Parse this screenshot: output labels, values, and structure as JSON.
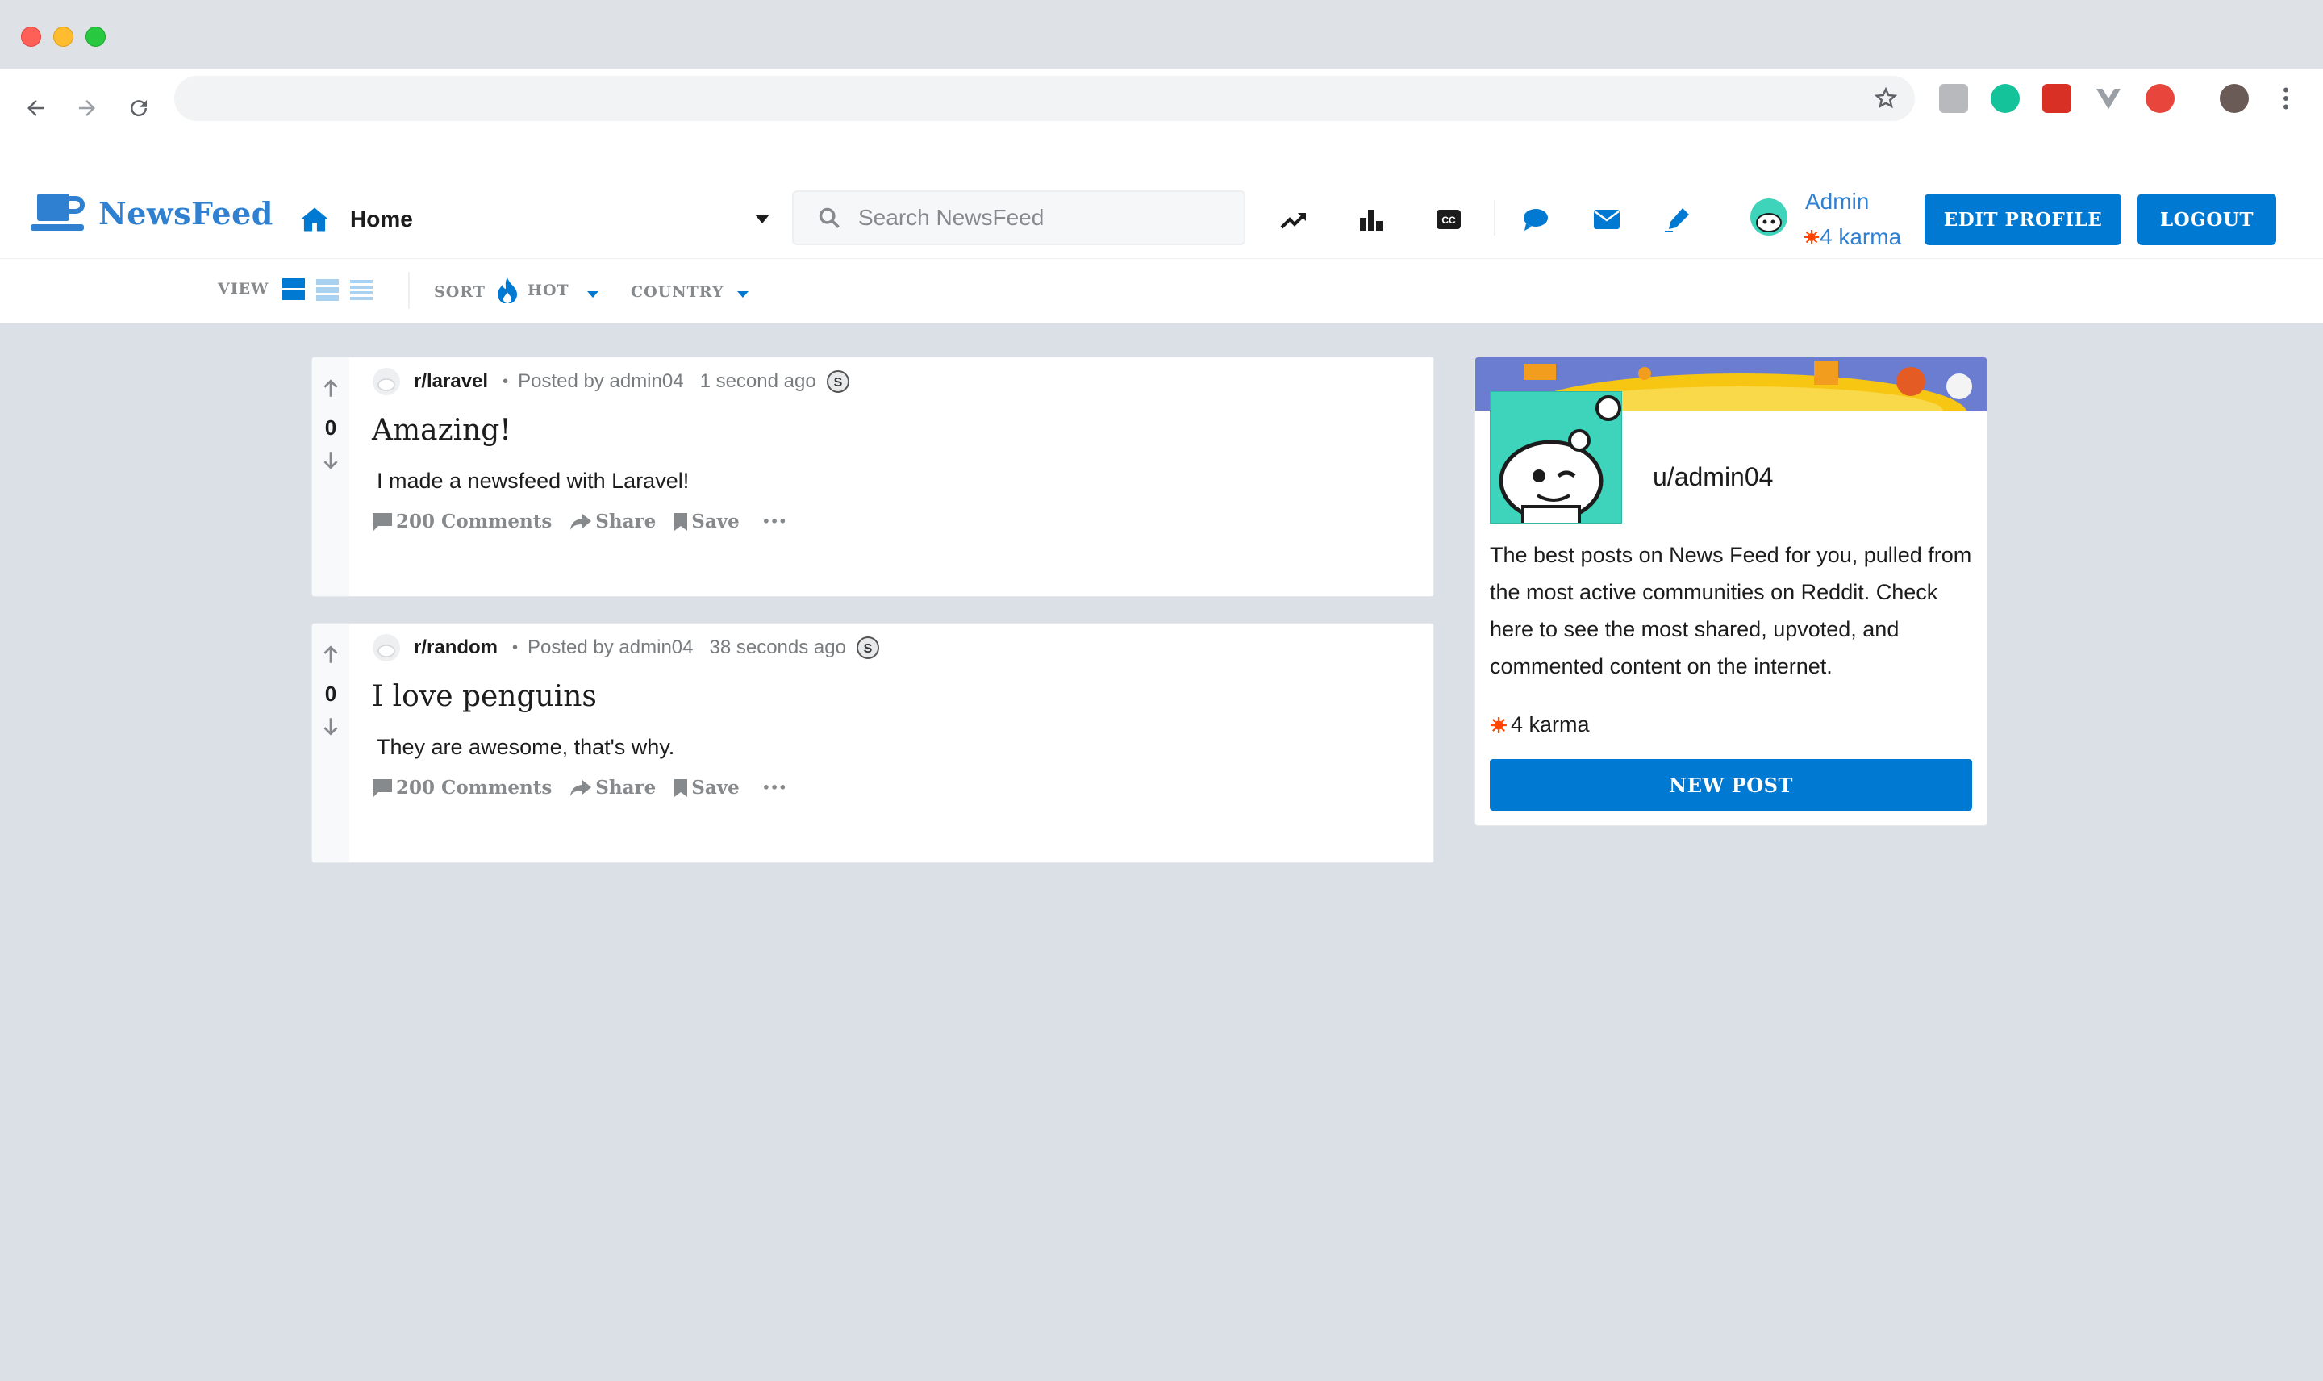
{
  "app": {
    "brand": "NewsFeed",
    "home_label": "Home",
    "search_placeholder": "Search NewsFeed",
    "user": {
      "name": "Admin",
      "karma": "4 karma"
    },
    "buttons": {
      "edit_profile": "EDIT PROFILE",
      "logout": "LOGOUT"
    },
    "header_icons": [
      "trending-icon",
      "leaderboard-icon",
      "closed-caption-icon",
      "chat-icon",
      "mail-icon",
      "pencil-icon"
    ]
  },
  "sortbar": {
    "view_label": "VIEW",
    "sort_label": "SORT",
    "sort_value": "HOT",
    "country_label": "COUNTRY"
  },
  "posts": [
    {
      "votes": "0",
      "subreddit": "r/laravel",
      "posted_by": "Posted by admin04",
      "time": "1 second ago",
      "title": "Amazing!",
      "body": "I made a newsfeed with Laravel!",
      "comments": "200 Comments",
      "share": "Share",
      "save": "Save",
      "more": "•••"
    },
    {
      "votes": "0",
      "subreddit": "r/random",
      "posted_by": "Posted by admin04",
      "time": "38 seconds ago",
      "title": "I love penguins",
      "body": "They are awesome, that's why.",
      "comments": "200 Comments",
      "share": "Share",
      "save": "Save",
      "more": "•••"
    }
  ],
  "sidebar": {
    "username": "u/admin04",
    "description": "The best posts on News Feed for you, pulled from the most active communities on Reddit. Check here to see the most shared, upvoted, and commented content on the internet.",
    "karma": "4 karma",
    "new_post": "NEW POST"
  },
  "colors": {
    "brand_blue": "#0079d3",
    "link_blue": "#2f80d1",
    "page_bg": "#dae0e6",
    "karma_red": "#ff4500"
  }
}
